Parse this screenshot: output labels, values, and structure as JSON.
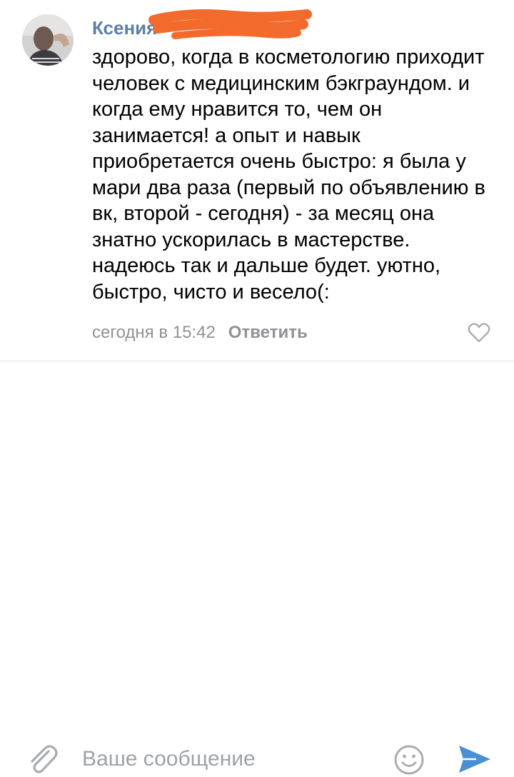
{
  "comment": {
    "author": "Ксения",
    "text": "здорово, когда в косметологию приходит человек с медицинским бэкграундом. и когда ему нравится то, чем он занимается! а опыт и навык приобретается очень быстро: я была у мари два раза (первый по объявлению в вк, второй - сегодня) - за месяц она знатно ускорилась в мастерстве. надеюсь так и дальше будет. уютно, быстро, чисто и весело(:",
    "date": "сегодня в 15:42",
    "reply_label": "Ответить"
  },
  "composer": {
    "placeholder": "Ваше сообщение"
  },
  "colors": {
    "author": "#5b7fa6",
    "meta": "#8f9196",
    "redaction": "#f26b2d",
    "send_accent": "#4a8fd4",
    "icon_gray": "#a9acb1"
  },
  "icons": {
    "heart": "heart-icon",
    "attach": "paperclip-icon",
    "emoji": "smile-icon",
    "send": "send-icon"
  }
}
